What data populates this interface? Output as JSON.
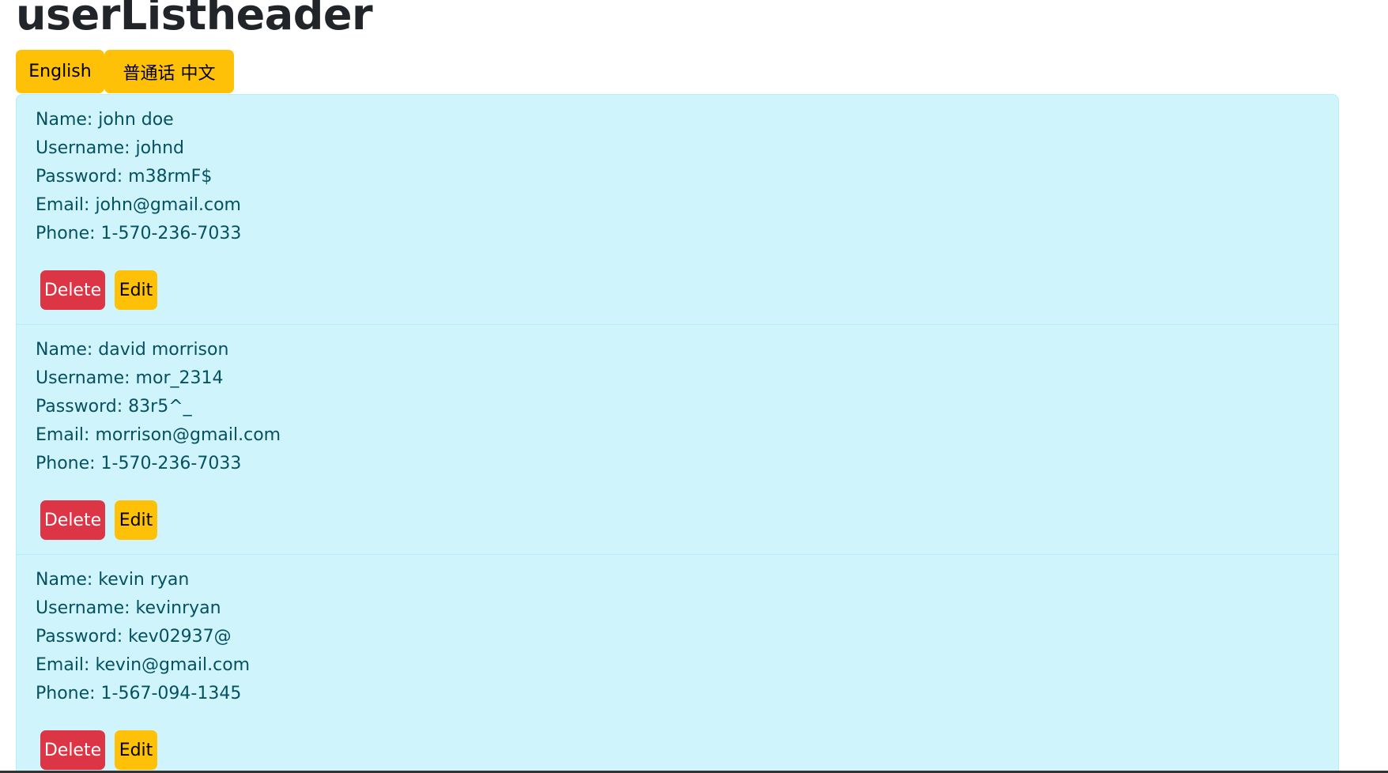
{
  "page": {
    "title": "userListheader"
  },
  "language_buttons": {
    "english": "English",
    "chinese": "普通话 中文"
  },
  "colors": {
    "card_background": "#cff4fc",
    "card_text": "#055160",
    "warning": "#ffc107",
    "danger": "#dc3545"
  },
  "users": [
    {
      "name": "Name: john doe",
      "username": "Username: johnd",
      "password": "Password: m38rmF$",
      "email": "Email: john@gmail.com",
      "phone": "Phone: 1-570-236-7033",
      "delete_label": "Delete",
      "edit_label": "Edit"
    },
    {
      "name": "Name: david morrison",
      "username": "Username: mor_2314",
      "password": "Password: 83r5^_",
      "email": "Email: morrison@gmail.com",
      "phone": "Phone: 1-570-236-7033",
      "delete_label": "Delete",
      "edit_label": "Edit"
    },
    {
      "name": "Name: kevin ryan",
      "username": "Username: kevinryan",
      "password": "Password: kev02937@",
      "email": "Email: kevin@gmail.com",
      "phone": "Phone: 1-567-094-1345",
      "delete_label": "Delete",
      "edit_label": "Edit"
    }
  ]
}
